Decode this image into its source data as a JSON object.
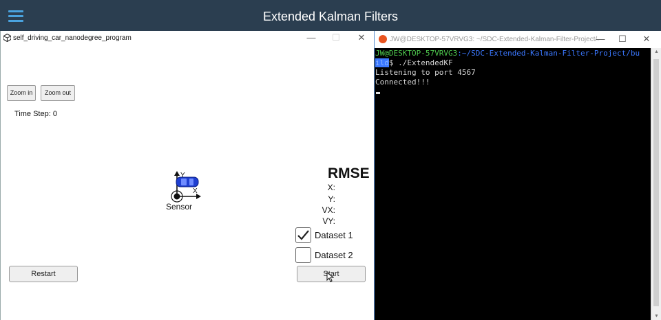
{
  "app": {
    "title": "Extended Kalman Filters"
  },
  "simulator": {
    "window_title": "self_driving_car_nanodegree_program",
    "controls": {
      "minimize": "—",
      "maximize": "☐",
      "close": "✕"
    },
    "zoom_in_label": "Zoom in",
    "zoom_out_label": "Zoom out",
    "time_step": "Time Step: 0",
    "sensor_label": "Sensor",
    "axis_y": "Y",
    "axis_x": "X",
    "rmse": {
      "title": "RMSE",
      "rows": [
        "X:",
        "Y:",
        "VX:",
        "VY:"
      ]
    },
    "datasets": [
      {
        "label": "Dataset 1",
        "checked": true
      },
      {
        "label": "Dataset 2",
        "checked": false
      }
    ],
    "restart_label": "Restart",
    "start_label": "Start"
  },
  "terminal": {
    "window_title": "JW@DESKTOP-57VRVG3: ~/SDC-Extended-Kalman-Filter-Project/...",
    "controls": {
      "minimize": "—",
      "maximize": "☐",
      "close": "✕"
    },
    "prompt_user": "JW@DESKTOP-57VRVG3",
    "prompt_path_line1": ":~/SDC-Extended-Kalman-Filter-Project/bu",
    "prompt_path_line2": "ild",
    "command": "$ ./ExtendedKF",
    "output": [
      "Listening to port 4567",
      "Connected!!!"
    ]
  },
  "colors": {
    "appbar": "#2b3e50",
    "accent": "#4aa3df",
    "terminal_bg": "#000000",
    "terminal_green": "#4ec94e",
    "terminal_blue": "#3b78ff",
    "car_blue": "#1f3fd1"
  }
}
